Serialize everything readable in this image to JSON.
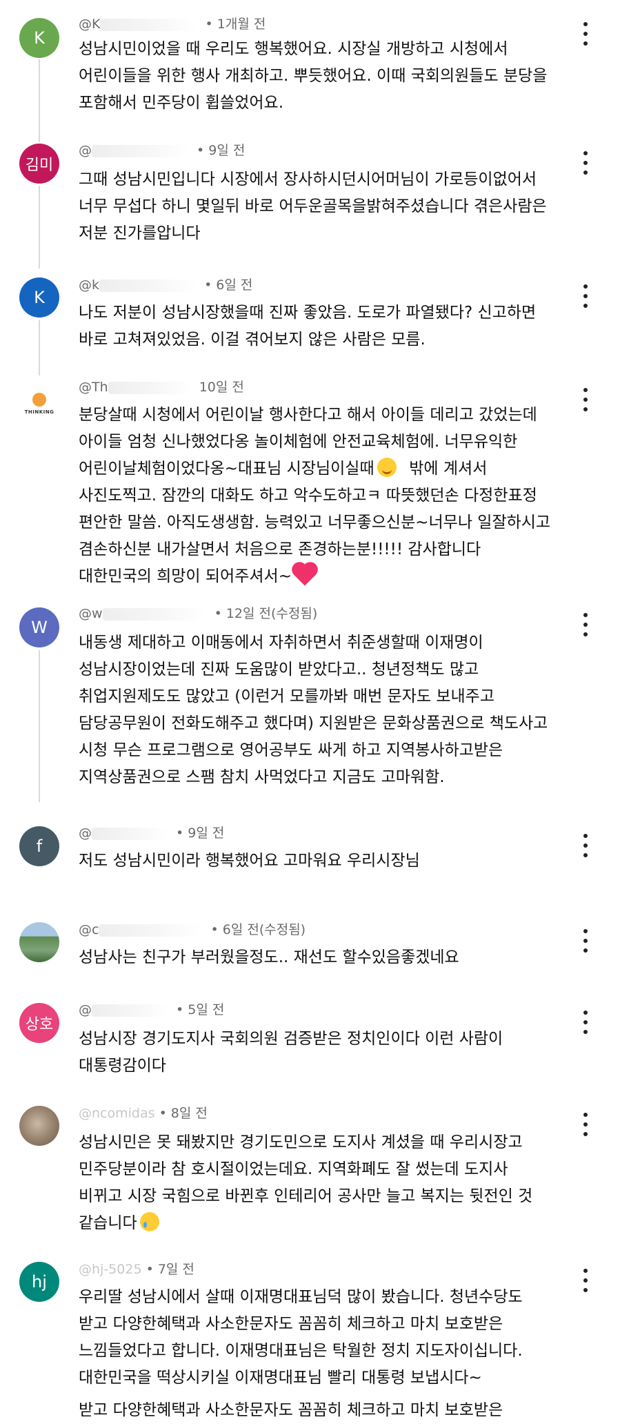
{
  "comments": [
    {
      "avatar_letter": "K",
      "avatar_color": "#6aa84f",
      "handle": "@K",
      "time": "• 1개월 전",
      "lines": [
        "성남시민이었을 때 우리도 행복했어요. 시장실 개방하고 시청에서",
        "어린이들을 위한 행사 개최하고. 뿌듯했어요. 이때 국회의원들도 분당을",
        "포함해서 민주당이 휩쓸었어요."
      ]
    },
    {
      "avatar_letter": "김미",
      "avatar_color": "#c2185b",
      "handle": "@",
      "time": "• 9일 전",
      "lines": [
        "그때 성남시민입니다  시장에서 장사하시던시어머님이 가로등이없어서",
        "너무 무섭다 하니  몇일뒤 바로 어두운골목을밝혀주셨습니다 겪은사람은",
        "저분 진가를압니다"
      ]
    },
    {
      "avatar_letter": "K",
      "avatar_color": "#1565c0",
      "handle": "@k",
      "time": "• 6일 전",
      "lines": [
        "나도 저분이 성남시장했을때 진짜 좋았음. 도로가 파열됐다? 신고하면",
        "바로 고쳐져있었음. 이걸 겪어보지 않은 사람은 모름."
      ]
    },
    {
      "avatar_letter": "THINKING",
      "avatar_color": "#ffffff",
      "handle": "@Th",
      "time": "10일 전",
      "lines": [
        "분당살때 시청에서 어린이날 행사한다고 해서 아이들 데리고 갔었는데",
        "아이들 엄청 신나했었다옹 놀이체험에 안전교육체험에. 너무유익한",
        "어린이날체험이었다옹~대표님 시장님이실때",
        "사진도찍고. 잠깐의 대화도 하고 악수도하고ㅋ  따뜻했던손 다정한표정",
        "편안한 말씀. 아직도생생함. 능력있고 너무좋으신분~너무나 일잘하시고",
        "겸손하신분 내가살면서 처음으로 존경하는분!!!!! 감사합니다",
        "대한민국의 희망이 되어주셔서~"
      ],
      "line3_tail": "밖에 계셔서"
    },
    {
      "avatar_letter": "W",
      "avatar_color": "#5c6bc0",
      "handle": "@w",
      "time": "• 12일 전(수정됨)",
      "lines": [
        "내동생 제대하고 이매동에서 자취하면서 취준생할때 이재명이",
        "성남시장이었는데 진짜 도움많이 받았다고.. 청년정책도 많고",
        "취업지원제도도 많았고 (이런거 모를까봐 매번 문자도 보내주고",
        "담당공무원이 전화도해주고 했다며) 지원받은 문화상품권으로 책도사고",
        "시청 무슨 프로그램으로 영어공부도 싸게 하고 지역봉사하고받은",
        "지역상품권으로 스팸 참치 사먹었다고 지금도 고마워함."
      ]
    },
    {
      "avatar_letter": "f",
      "avatar_color": "#455a64",
      "handle": "@",
      "time": "• 9일 전",
      "lines": [
        "저도 성남시민이라 행복했어요 고마워요 우리시장님"
      ]
    },
    {
      "avatar_letter": "",
      "avatar_color": "#7fa37a",
      "handle": "@c",
      "time": "• 6일 전(수정됨)",
      "lines": [
        "성남사는 친구가 부러웠을정도.. 재선도 할수있음좋겠네요"
      ]
    },
    {
      "avatar_letter": "상호",
      "avatar_color": "#e8437a",
      "handle": "@",
      "time": "• 5일 전",
      "lines": [
        "성남시장 경기도지사 국회의원 검증받은 정치인이다 이런 사람이",
        "대통령감이다"
      ]
    },
    {
      "avatar_letter": "",
      "avatar_color": "#8d7b6b",
      "handle": "@ncomidas",
      "time": "• 8일 전",
      "lines": [
        "성남시민은 못 돼봤지만 경기도민으로 도지사 계셨을 때 우리시장고",
        "민주당분이라 참 호시절이었는데요. 지역화폐도 잘 썼는데 도지사",
        "비뀌고 시장 국힘으로 바뀐후 인테리어 공사만 늘고 복지는 뒷전인 것",
        "같습니다"
      ]
    },
    {
      "avatar_letter": "hj",
      "avatar_color": "#00897b",
      "handle": "@hj-5025",
      "time": "• 7일 전",
      "lines": [
        "우리딸 성남시에서 살때 이재명대표님덕 많이 봤습니다. 청년수당도",
        "받고 다양한혜택과 사소한문자도 꼼꼼히 체크하고 마치 보호받은",
        "느낌들었다고 합니다. 이재명대표님은 탁월한 정치 지도자이십니다.",
        "대한민국을 떡상시키실 이재명대표님 빨리 대통령 보냅시다~",
        "받고 다양한혜택과 사소한문자도 꼼꼼히 체크하고 마치 보호받은"
      ]
    }
  ]
}
